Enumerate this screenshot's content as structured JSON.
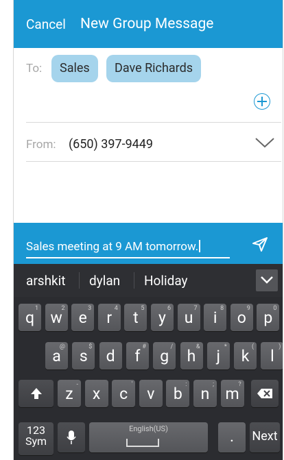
{
  "header": {
    "cancel_label": "Cancel",
    "title": "New Group Message"
  },
  "recipients": {
    "to_label": "To:",
    "chips": [
      "Sales",
      "Dave Richards"
    ]
  },
  "from": {
    "label": "From:",
    "number": "(650) 397-9449"
  },
  "composer": {
    "message": "Sales meeting at 9 AM tomorrow."
  },
  "keyboard": {
    "suggestions": [
      "arshkit",
      "dylan",
      "Holiday"
    ],
    "row1": [
      {
        "k": "q",
        "s": "1"
      },
      {
        "k": "w",
        "s": "2"
      },
      {
        "k": "e",
        "s": "3"
      },
      {
        "k": "r",
        "s": "4"
      },
      {
        "k": "t",
        "s": "5"
      },
      {
        "k": "y",
        "s": "6"
      },
      {
        "k": "u",
        "s": "7"
      },
      {
        "k": "i",
        "s": "8"
      },
      {
        "k": "o",
        "s": "9"
      },
      {
        "k": "p",
        "s": "0"
      }
    ],
    "row2": [
      {
        "k": "a",
        "s": "@"
      },
      {
        "k": "s",
        "s": "$"
      },
      {
        "k": "d",
        "s": ""
      },
      {
        "k": "f",
        "s": "#"
      },
      {
        "k": "g",
        "s": "/"
      },
      {
        "k": "h",
        "s": "&"
      },
      {
        "k": "j",
        "s": "*"
      },
      {
        "k": "k",
        "s": "("
      },
      {
        "k": "l",
        "s": ")"
      }
    ],
    "row3": [
      {
        "k": "z",
        "s": "-"
      },
      {
        "k": "x",
        "s": ""
      },
      {
        "k": "c",
        "s": "'"
      },
      {
        "k": "v",
        "s": ""
      },
      {
        "k": "b",
        "s": ":"
      },
      {
        "k": "n",
        "s": ";"
      },
      {
        "k": "m",
        "s": "?"
      }
    ],
    "sym_line1": "123",
    "sym_line2": "Sym",
    "space_label": "English(US)",
    "period_label": ".",
    "next_label": "Next"
  }
}
